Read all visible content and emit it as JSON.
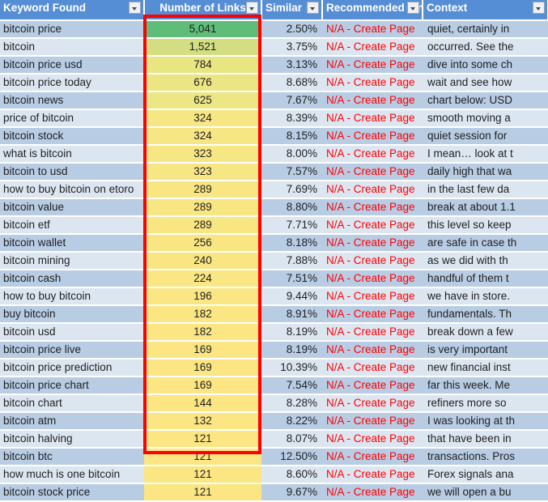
{
  "table": {
    "columns": [
      {
        "key": "keyword",
        "label": "Keyword Found",
        "filter_icon": "chevron-down-icon"
      },
      {
        "key": "links",
        "label": "Number of Links",
        "filter_icon": "chevron-down-icon"
      },
      {
        "key": "similarity",
        "label": "Similar",
        "filter_icon": "chevron-down-icon"
      },
      {
        "key": "recommended",
        "label": "Recommended Link",
        "filter_icon": "chevron-down-icon"
      },
      {
        "key": "context",
        "label": "Context",
        "filter_icon": "chevron-down-icon"
      }
    ],
    "rows": [
      {
        "keyword": "bitcoin price",
        "links": "5,041",
        "similarity": "2.50%",
        "recommended": "N/A - Create Page",
        "context": "quiet, certainly in",
        "fill": "#5fbd79"
      },
      {
        "keyword": "bitcoin",
        "links": "1,521",
        "similarity": "3.75%",
        "recommended": "N/A - Create Page",
        "context": "occurred. See the",
        "fill": "#d3de82"
      },
      {
        "keyword": "bitcoin price usd",
        "links": "784",
        "similarity": "3.13%",
        "recommended": "N/A - Create Page",
        "context": "dive into some ch",
        "fill": "#e8e583"
      },
      {
        "keyword": "bitcoin price today",
        "links": "676",
        "similarity": "8.68%",
        "recommended": "N/A - Create Page",
        "context": "wait and see how",
        "fill": "#ebe584"
      },
      {
        "keyword": "bitcoin news",
        "links": "625",
        "similarity": "7.67%",
        "recommended": "N/A - Create Page",
        "context": "chart below: USD",
        "fill": "#ece684"
      },
      {
        "keyword": "price of bitcoin",
        "links": "324",
        "similarity": "8.39%",
        "recommended": "N/A - Create Page",
        "context": "smooth moving a",
        "fill": "#f6e684"
      },
      {
        "keyword": "bitcoin stock",
        "links": "324",
        "similarity": "8.15%",
        "recommended": "N/A - Create Page",
        "context": "quiet session for",
        "fill": "#f6e684"
      },
      {
        "keyword": "what is bitcoin",
        "links": "323",
        "similarity": "8.00%",
        "recommended": "N/A - Create Page",
        "context": "I mean… look at t",
        "fill": "#f6e684"
      },
      {
        "keyword": "bitcoin to usd",
        "links": "323",
        "similarity": "7.57%",
        "recommended": "N/A - Create Page",
        "context": "daily high that wa",
        "fill": "#f6e684"
      },
      {
        "keyword": "how to buy bitcoin on etoro",
        "links": "289",
        "similarity": "7.69%",
        "recommended": "N/A - Create Page",
        "context": "in the last few da",
        "fill": "#f8e683"
      },
      {
        "keyword": "bitcoin value",
        "links": "289",
        "similarity": "8.80%",
        "recommended": "N/A - Create Page",
        "context": "break at about 1.1",
        "fill": "#f8e683"
      },
      {
        "keyword": "bitcoin etf",
        "links": "289",
        "similarity": "7.71%",
        "recommended": "N/A - Create Page",
        "context": "this level so keep",
        "fill": "#f8e683"
      },
      {
        "keyword": "bitcoin wallet",
        "links": "256",
        "similarity": "8.18%",
        "recommended": "N/A - Create Page",
        "context": "are safe in case th",
        "fill": "#f9e683"
      },
      {
        "keyword": "bitcoin mining",
        "links": "240",
        "similarity": "7.88%",
        "recommended": "N/A - Create Page",
        "context": "as we did with th",
        "fill": "#f9e683"
      },
      {
        "keyword": "bitcoin cash",
        "links": "224",
        "similarity": "7.51%",
        "recommended": "N/A - Create Page",
        "context": "handful of them t",
        "fill": "#fae683"
      },
      {
        "keyword": "how to buy bitcoin",
        "links": "196",
        "similarity": "9.44%",
        "recommended": "N/A - Create Page",
        "context": "we have in store.",
        "fill": "#fae683"
      },
      {
        "keyword": "buy bitcoin",
        "links": "182",
        "similarity": "8.91%",
        "recommended": "N/A - Create Page",
        "context": "fundamentals. Th",
        "fill": "#fbe683"
      },
      {
        "keyword": "bitcoin usd",
        "links": "182",
        "similarity": "8.19%",
        "recommended": "N/A - Create Page",
        "context": "break down a few",
        "fill": "#fbe683"
      },
      {
        "keyword": "bitcoin price live",
        "links": "169",
        "similarity": "8.19%",
        "recommended": "N/A - Create Page",
        "context": "is very important",
        "fill": "#fbe683"
      },
      {
        "keyword": "bitcoin price prediction",
        "links": "169",
        "similarity": "10.39%",
        "recommended": "N/A - Create Page",
        "context": "new financial inst",
        "fill": "#fbe683"
      },
      {
        "keyword": "bitcoin price chart",
        "links": "169",
        "similarity": "7.54%",
        "recommended": "N/A - Create Page",
        "context": "far this week. Me",
        "fill": "#fbe683"
      },
      {
        "keyword": "bitcoin chart",
        "links": "144",
        "similarity": "8.28%",
        "recommended": "N/A - Create Page",
        "context": "refiners more so",
        "fill": "#fce683"
      },
      {
        "keyword": "bitcoin atm",
        "links": "132",
        "similarity": "8.22%",
        "recommended": "N/A - Create Page",
        "context": "I was looking at th",
        "fill": "#fce683"
      },
      {
        "keyword": "bitcoin halving",
        "links": "121",
        "similarity": "8.07%",
        "recommended": "N/A - Create Page",
        "context": "that have been in",
        "fill": "#fce683"
      },
      {
        "keyword": "bitcoin btc",
        "links": "121",
        "similarity": "12.50%",
        "recommended": "N/A - Create Page",
        "context": "transactions. Pros",
        "fill": "#fce683"
      },
      {
        "keyword": "how much is one bitcoin",
        "links": "121",
        "similarity": "8.60%",
        "recommended": "N/A - Create Page",
        "context": "Forex signals ana",
        "fill": "#fce683"
      },
      {
        "keyword": "bitcoin stock price",
        "links": "121",
        "similarity": "9.67%",
        "recommended": "N/A - Create Page",
        "context": "we will open a bu",
        "fill": "#fce683"
      }
    ]
  },
  "highlight": {
    "name": "number-of-links-highlight",
    "color": "#ff0000"
  }
}
